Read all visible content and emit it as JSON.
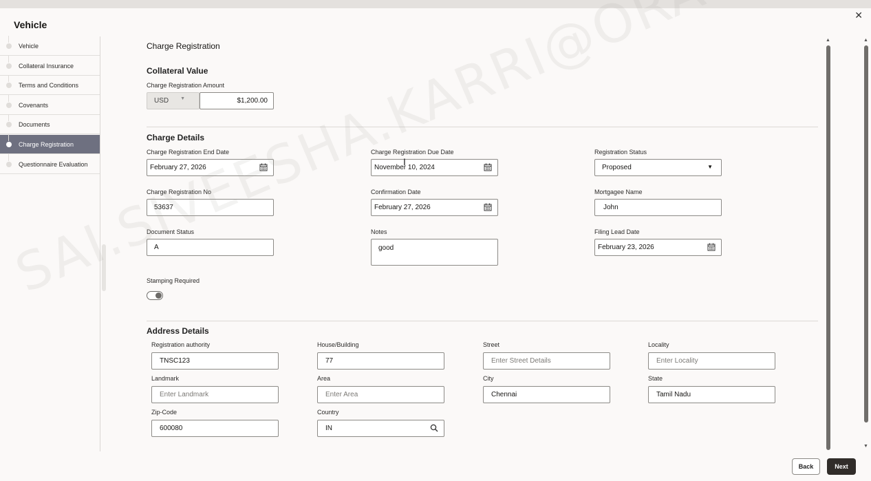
{
  "window": {
    "title": "Vehicle",
    "close_glyph": "✕"
  },
  "sidebar": {
    "items": [
      {
        "label": "Vehicle"
      },
      {
        "label": "Collateral Insurance"
      },
      {
        "label": "Terms and Conditions"
      },
      {
        "label": "Covenants"
      },
      {
        "label": "Documents"
      },
      {
        "label": "Charge Registration",
        "active": true
      },
      {
        "label": "Questionnaire Evaluation"
      }
    ]
  },
  "page": {
    "title": "Charge Registration",
    "collateral_value": {
      "heading": "Collateral Value",
      "amount_label": "Charge Registration Amount",
      "currency": "USD",
      "amount": "$1,200.00"
    },
    "charge_details": {
      "heading": "Charge Details",
      "end_date_label": "Charge Registration End Date",
      "end_date": "February 27, 2026",
      "due_date_label": "Charge Registration Due Date",
      "due_date": "November 10, 2024",
      "status_label": "Registration Status",
      "status": "Proposed",
      "reg_no_label": "Charge Registration No",
      "reg_no": "53637",
      "confirmation_label": "Confirmation Date",
      "confirmation_date": "February 27, 2026",
      "mortgagee_label": "Mortgagee Name",
      "mortgagee": "John",
      "doc_status_label": "Document Status",
      "doc_status": "A",
      "notes_label": "Notes",
      "notes": "good",
      "filing_label": "Filing Lead Date",
      "filing_date": "February 23, 2026",
      "stamping_label": "Stamping Required"
    },
    "address": {
      "heading": "Address Details",
      "authority_label": "Registration authority",
      "authority": "TNSC123",
      "house_label": "House/Building",
      "house": "77",
      "street_label": "Street",
      "street_placeholder": "Enter Street Details",
      "locality_label": "Locality",
      "locality_placeholder": "Enter Locality",
      "landmark_label": "Landmark",
      "landmark_placeholder": "Enter Landmark",
      "area_label": "Area",
      "area_placeholder": "Enter Area",
      "city_label": "City",
      "city": "Chennai",
      "state_label": "State",
      "state": "Tamil Nadu",
      "zip_label": "Zip-Code",
      "zip": "600080",
      "country_label": "Country",
      "country": "IN"
    }
  },
  "footer": {
    "back": "Back",
    "next": "Next"
  },
  "watermark": "SAI.SIVEESHA.KARRI@ORACLE.COM",
  "colors": {
    "active_nav": "#6e7080",
    "primary_button": "#312d2a"
  }
}
